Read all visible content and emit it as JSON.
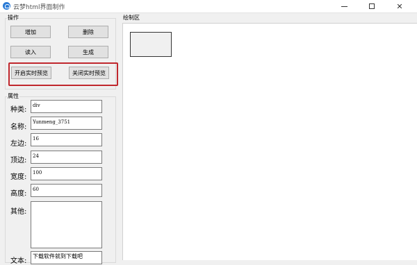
{
  "window": {
    "title": "云梦html界面制作",
    "minimize_glyph": "—",
    "maximize_glyph": "☐",
    "close_glyph": "✕"
  },
  "operations": {
    "group_label": "操作",
    "add_label": "增加",
    "delete_label": "删除",
    "read_label": "读入",
    "generate_label": "生成",
    "open_preview_label": "开启实时预览",
    "close_preview_label": "关闭实时预览"
  },
  "properties": {
    "group_label": "属性",
    "kind": {
      "label": "种类:",
      "value": "div"
    },
    "name": {
      "label": "名称:",
      "value": "Yunmeng_3751"
    },
    "left": {
      "label": "左边:",
      "value": "16"
    },
    "top": {
      "label": "顶边:",
      "value": "24"
    },
    "width": {
      "label": "宽度:",
      "value": "100"
    },
    "height": {
      "label": "高度:",
      "value": "60"
    },
    "other": {
      "label": "其他:",
      "value": ""
    },
    "text": {
      "label": "文本:",
      "value": "下载软件就到下载吧"
    }
  },
  "canvas": {
    "group_label": "绘制区"
  },
  "colors": {
    "highlight": "#c0272d",
    "window_bg": "#f0f0f0",
    "app_icon": "#2b7bd6"
  },
  "icons": {
    "app": "app-logo-icon",
    "minimize": "minimize-icon",
    "maximize": "maximize-icon",
    "close": "close-icon"
  }
}
